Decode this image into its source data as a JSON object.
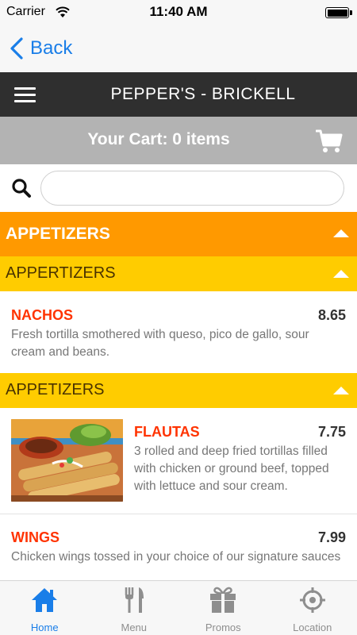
{
  "status_bar": {
    "carrier": "Carrier",
    "time": "11:40 AM"
  },
  "nav": {
    "back_label": "Back"
  },
  "header": {
    "title": "PEPPER'S - BRICKELL"
  },
  "cart": {
    "label": "Your Cart: 0 items"
  },
  "search": {
    "placeholder": "",
    "value": ""
  },
  "menu": {
    "category": "APPETIZERS",
    "sections": [
      {
        "title": "APPERTIZERS",
        "items": [
          {
            "name": "NACHOS",
            "price": "8.65",
            "description": "Fresh tortilla smothered with queso, pico de gallo, sour cream and beans."
          }
        ]
      },
      {
        "title": "APPETIZERS",
        "items": [
          {
            "name": "FLAUTAS",
            "price": "7.75",
            "description": "3 rolled and deep fried tortillas filled with chicken or ground beef, topped with lettuce and sour cream.",
            "has_photo": true
          },
          {
            "name": "WINGS",
            "price": "7.99",
            "description": "Chicken wings tossed in your choice of our signature sauces"
          }
        ]
      }
    ]
  },
  "tabs": [
    {
      "label": "Home",
      "icon": "home-icon",
      "active": true
    },
    {
      "label": "Menu",
      "icon": "utensils-icon",
      "active": false
    },
    {
      "label": "Promos",
      "icon": "gift-icon",
      "active": false
    },
    {
      "label": "Location",
      "icon": "location-icon",
      "active": false
    }
  ],
  "colors": {
    "accent_blue": "#1a7ee8",
    "category_orange": "#ff9900",
    "section_yellow": "#ffcc00",
    "item_name_red": "#ff3300",
    "header_dark": "#2f2f2f",
    "cart_gray": "#b3b3b3"
  }
}
